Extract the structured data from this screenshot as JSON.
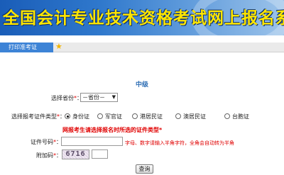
{
  "header": {
    "title": "全国会计专业技术资格考试网上报名系统"
  },
  "nav": {
    "tab_label": "打印准考证",
    "star_icon": "★"
  },
  "form": {
    "level_title": "中级",
    "province": {
      "label": "选择省份",
      "required": "*",
      "value": "－省份－",
      "arrow": "▼"
    },
    "id_type": {
      "label": "选择报考证件类型",
      "required": "*",
      "options": [
        {
          "label": "身份证",
          "checked": true
        },
        {
          "label": "军官证",
          "checked": false
        },
        {
          "label": "港居民证",
          "checked": false
        },
        {
          "label": "澳居民证",
          "checked": false
        },
        {
          "label": "台胞证",
          "checked": false
        }
      ]
    },
    "warning": "网报考生请选择报名时所选的证件类型*",
    "id_number": {
      "label": "证件号码",
      "required": "*",
      "value": "",
      "hint": "字母、数字请输入半角字符，全角会自动转为半角"
    },
    "captcha": {
      "label": "附加码",
      "required": "*",
      "code": "6716",
      "value": ""
    },
    "submit_label": "查询"
  }
}
